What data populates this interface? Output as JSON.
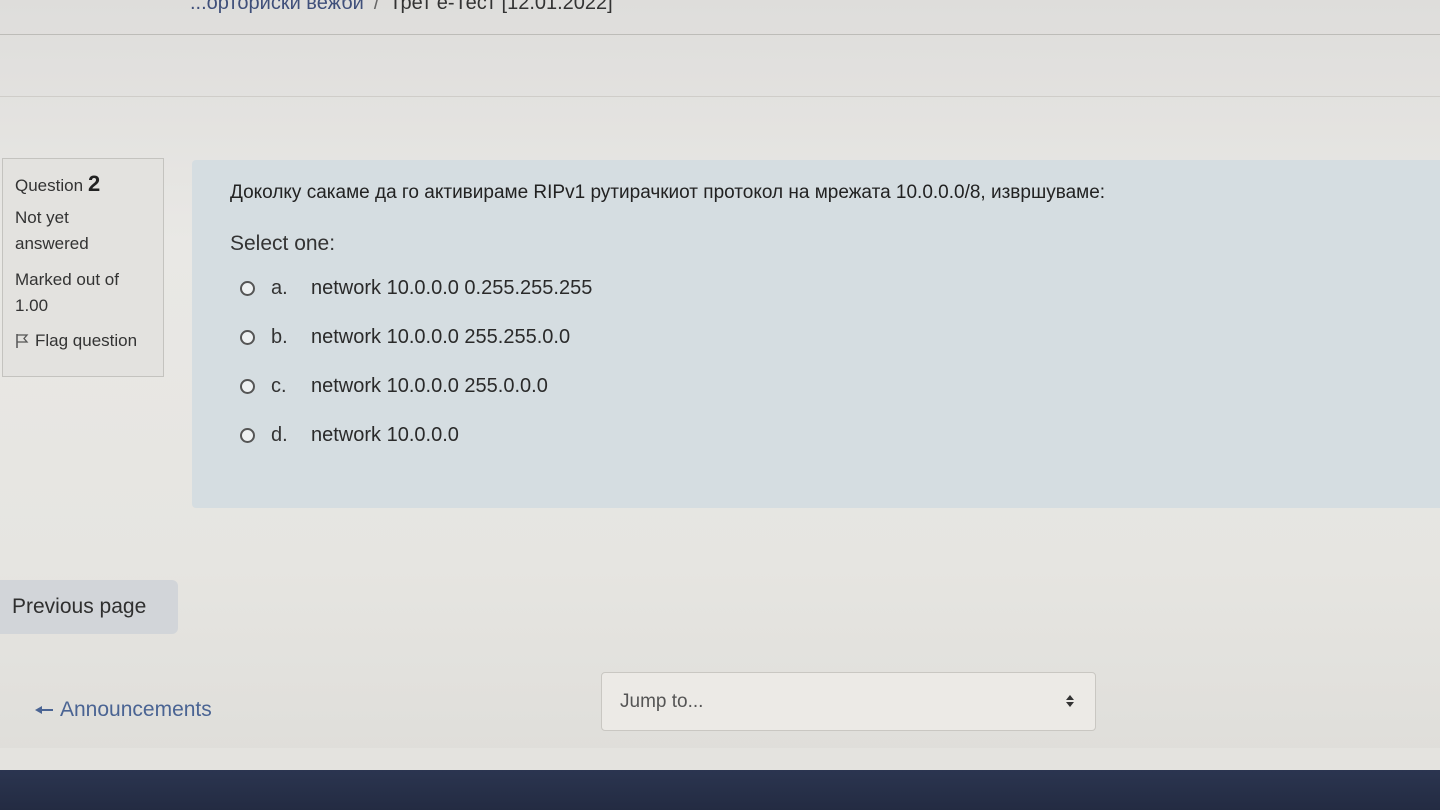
{
  "breadcrumb": {
    "parent": "...орториски вежби",
    "separator": "/",
    "current": "Трет е-Тест [12.01.2022]"
  },
  "question_info": {
    "label": "Question",
    "number": "2",
    "state": "Not yet answered",
    "grade": "Marked out of 1.00",
    "flag_label": "Flag question"
  },
  "question": {
    "text": "Доколку сакаме да го активираме RIPv1 рутирачкиот протокол на мрежата 10.0.0.0/8, извршуваме:",
    "prompt": "Select one:",
    "answers": [
      {
        "letter": "a.",
        "text": "network 10.0.0.0 0.255.255.255"
      },
      {
        "letter": "b.",
        "text": "network 10.0.0.0 255.255.0.0"
      },
      {
        "letter": "c.",
        "text": "network 10.0.0.0 255.0.0.0"
      },
      {
        "letter": "d.",
        "text": "network 10.0.0.0"
      }
    ]
  },
  "navigation": {
    "previous_page": "Previous page",
    "previous_activity": "Announcements",
    "jump_to_placeholder": "Jump to..."
  },
  "colors": {
    "question_bg": "#d5dde1",
    "link": "#4a6493",
    "footer": "#2b3550"
  }
}
